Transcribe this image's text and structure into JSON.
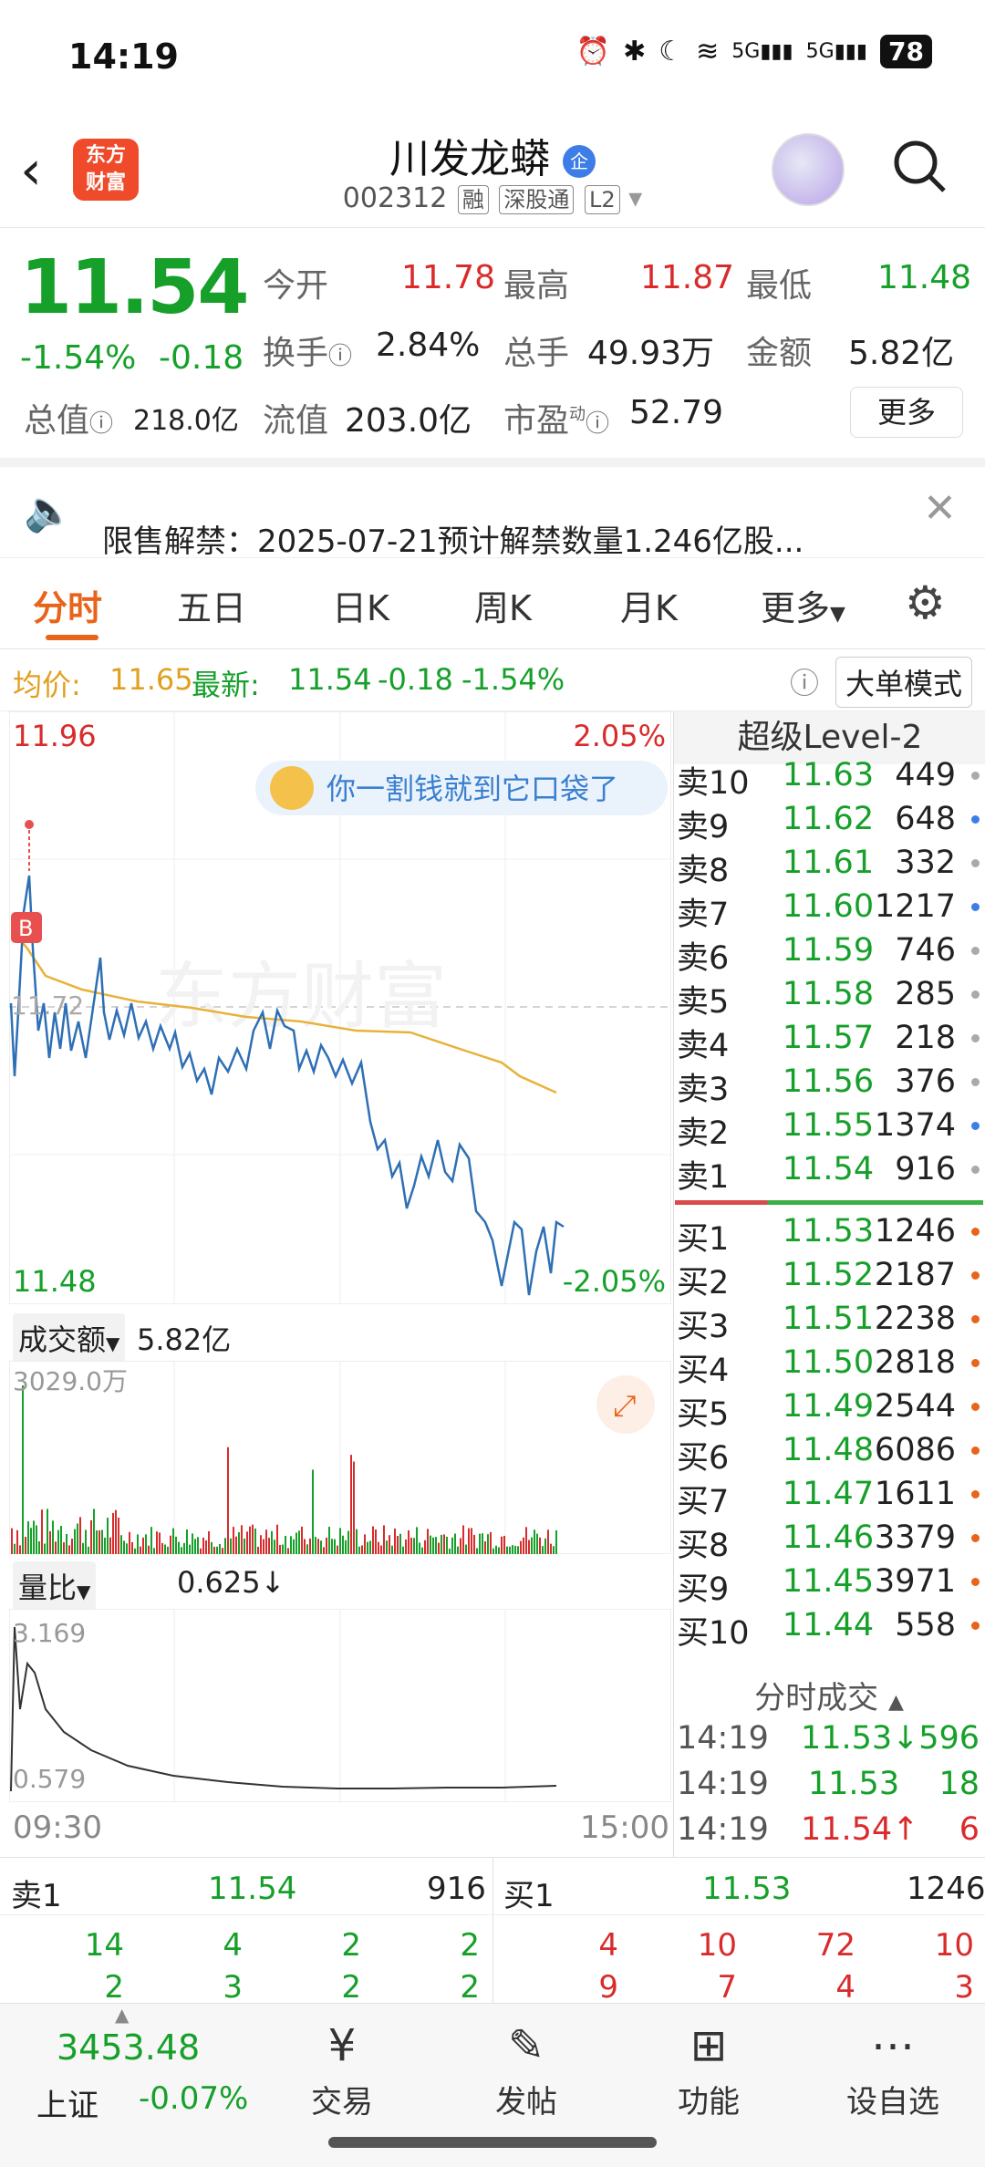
{
  "status": {
    "time": "14:19",
    "battery": "78",
    "net1": "5G",
    "net2": "5G"
  },
  "header": {
    "logo": "东方\n财富",
    "title": "川发龙蟒",
    "corp_badge": "企",
    "code": "002312",
    "tags": [
      "融",
      "深股通",
      "L2"
    ]
  },
  "quote": {
    "price": "11.54",
    "pct": "-1.54%",
    "chg": "-0.18",
    "open_label": "今开",
    "open": "11.78",
    "high_label": "最高",
    "high": "11.87",
    "low_label": "最低",
    "low": "11.48",
    "turn_label": "换手",
    "turn": "2.84%",
    "vol_label": "总手",
    "vol": "49.93万",
    "amt_label": "金额",
    "amt": "5.82亿",
    "mcap_label": "总值",
    "mcap": "218.0亿",
    "float_label": "流值",
    "float": "203.0亿",
    "pe_label": "市盈",
    "pe_sup": "动",
    "pe": "52.79",
    "more": "更多"
  },
  "notice": {
    "text": "限售解禁：2025-07-21预计解禁数量1.246亿股..."
  },
  "tabs": [
    "分时",
    "五日",
    "日K",
    "周K",
    "月K",
    "更多"
  ],
  "pricebar": {
    "avg_label": "均价:",
    "avg": "11.65",
    "last_label": "最新:",
    "last": "11.54",
    "chg": "-0.18",
    "pct": "-1.54%",
    "mode": "大单模式"
  },
  "chart": {
    "ymax": "11.96",
    "ymin": "11.48",
    "pmax": "2.05%",
    "pmin": "-2.05%",
    "mid": "11.72",
    "bubble": "你一割钱就到它口袋了",
    "watermark": "东方财富",
    "b_mark": "B",
    "vol_label": "成交额",
    "vol_total": "5.82亿",
    "vol_max": "3029.0万",
    "ratio_label": "量比",
    "ratio_val": "0.625↓",
    "ratio_max": "3.169",
    "ratio_min": "0.579",
    "t_start": "09:30",
    "t_end": "15:00"
  },
  "level2": {
    "title": "超级Level-2",
    "asks": [
      [
        "卖10",
        "11.63",
        "449"
      ],
      [
        "卖9",
        "11.62",
        "648"
      ],
      [
        "卖8",
        "11.61",
        "332"
      ],
      [
        "卖7",
        "11.60",
        "1217"
      ],
      [
        "卖6",
        "11.59",
        "746"
      ],
      [
        "卖5",
        "11.58",
        "285"
      ],
      [
        "卖4",
        "11.57",
        "218"
      ],
      [
        "卖3",
        "11.56",
        "376"
      ],
      [
        "卖2",
        "11.55",
        "1374"
      ],
      [
        "卖1",
        "11.54",
        "916"
      ]
    ],
    "bids": [
      [
        "买1",
        "11.53",
        "1246"
      ],
      [
        "买2",
        "11.52",
        "2187"
      ],
      [
        "买3",
        "11.51",
        "2238"
      ],
      [
        "买4",
        "11.50",
        "2818"
      ],
      [
        "买5",
        "11.49",
        "2544"
      ],
      [
        "买6",
        "11.48",
        "6086"
      ],
      [
        "买7",
        "11.47",
        "1611"
      ],
      [
        "买8",
        "11.46",
        "3379"
      ],
      [
        "买9",
        "11.45",
        "3971"
      ],
      [
        "买10",
        "11.44",
        "558"
      ]
    ],
    "trades_title": "分时成交",
    "trades": [
      [
        "14:19",
        "11.53↓",
        "596"
      ],
      [
        "14:19",
        "11.53",
        "18"
      ],
      [
        "14:19",
        "11.54↑",
        "6"
      ]
    ]
  },
  "queue": {
    "sell_label": "卖1",
    "sell_price": "11.54",
    "sell_vol": "916",
    "buy_label": "买1",
    "buy_price": "11.53",
    "buy_vol": "1246",
    "sell_row1": [
      "14",
      "4",
      "2",
      "2"
    ],
    "buy_row1": [
      "4",
      "10",
      "72",
      "10"
    ],
    "sell_row2": [
      "2",
      "3",
      "2",
      "2"
    ],
    "buy_row2": [
      "9",
      "7",
      "4",
      "3"
    ]
  },
  "bottom": {
    "index_val": "3453.48",
    "index_name": "上证",
    "index_pct": "-0.07%",
    "nav": [
      "交易",
      "发帖",
      "功能",
      "设自选"
    ]
  },
  "colors": {
    "up": "#d92b2b",
    "down": "#16a02a",
    "price_line": "#2e6fb5",
    "avg_line": "#e8b23a",
    "accent": "#e8641a"
  }
}
